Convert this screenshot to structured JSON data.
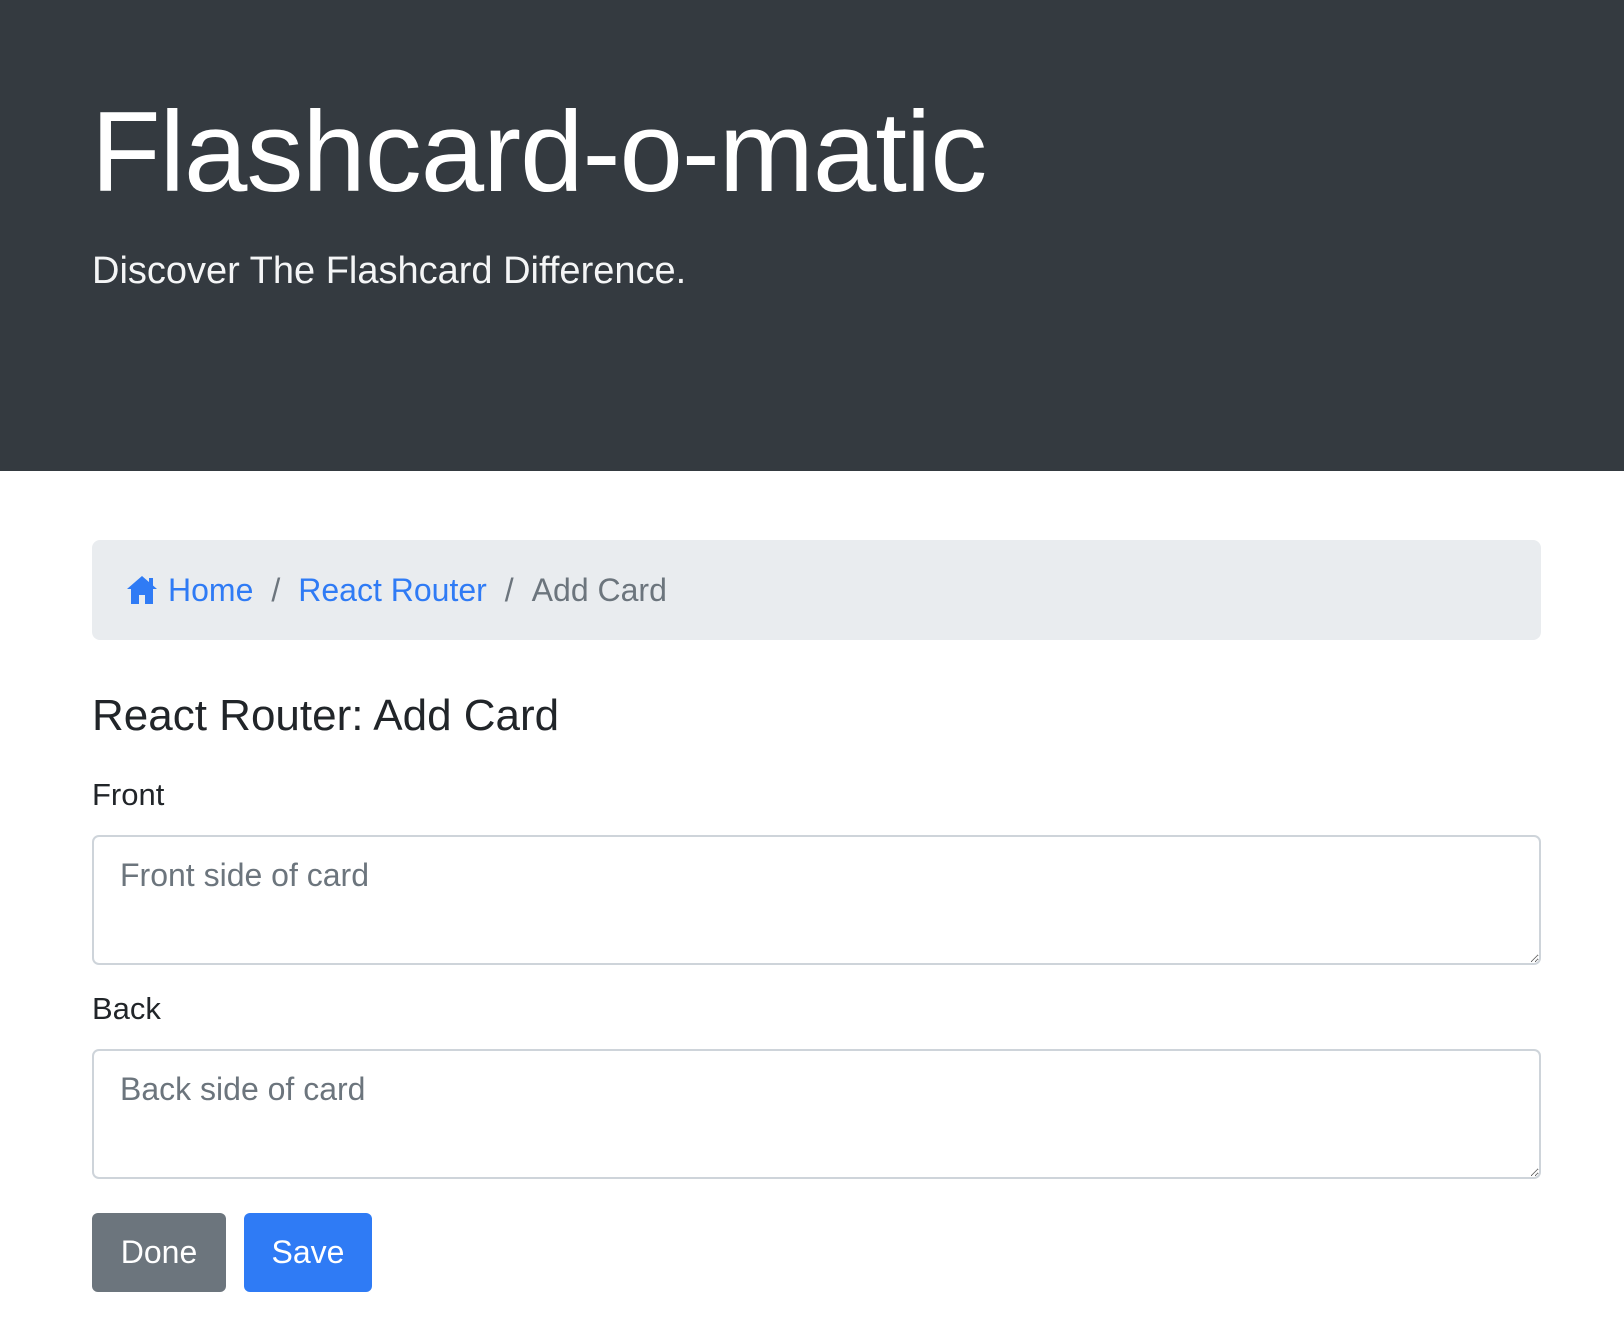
{
  "header": {
    "title": "Flashcard-o-matic",
    "subtitle": "Discover The Flashcard Difference."
  },
  "breadcrumb": {
    "home_icon": "home-icon",
    "home": "Home",
    "separator": "/",
    "deck": "React Router",
    "current": "Add Card"
  },
  "page": {
    "heading": "React Router: Add Card"
  },
  "form": {
    "front_label": "Front",
    "front_placeholder": "Front side of card",
    "front_value": "",
    "back_label": "Back",
    "back_placeholder": "Back side of card",
    "back_value": "",
    "done_label": "Done",
    "save_label": "Save"
  },
  "colors": {
    "header_bg": "#343a40",
    "breadcrumb_bg": "#e9ecef",
    "link": "#2f7bf5",
    "secondary": "#6c757d",
    "primary": "#2f7bf5"
  }
}
